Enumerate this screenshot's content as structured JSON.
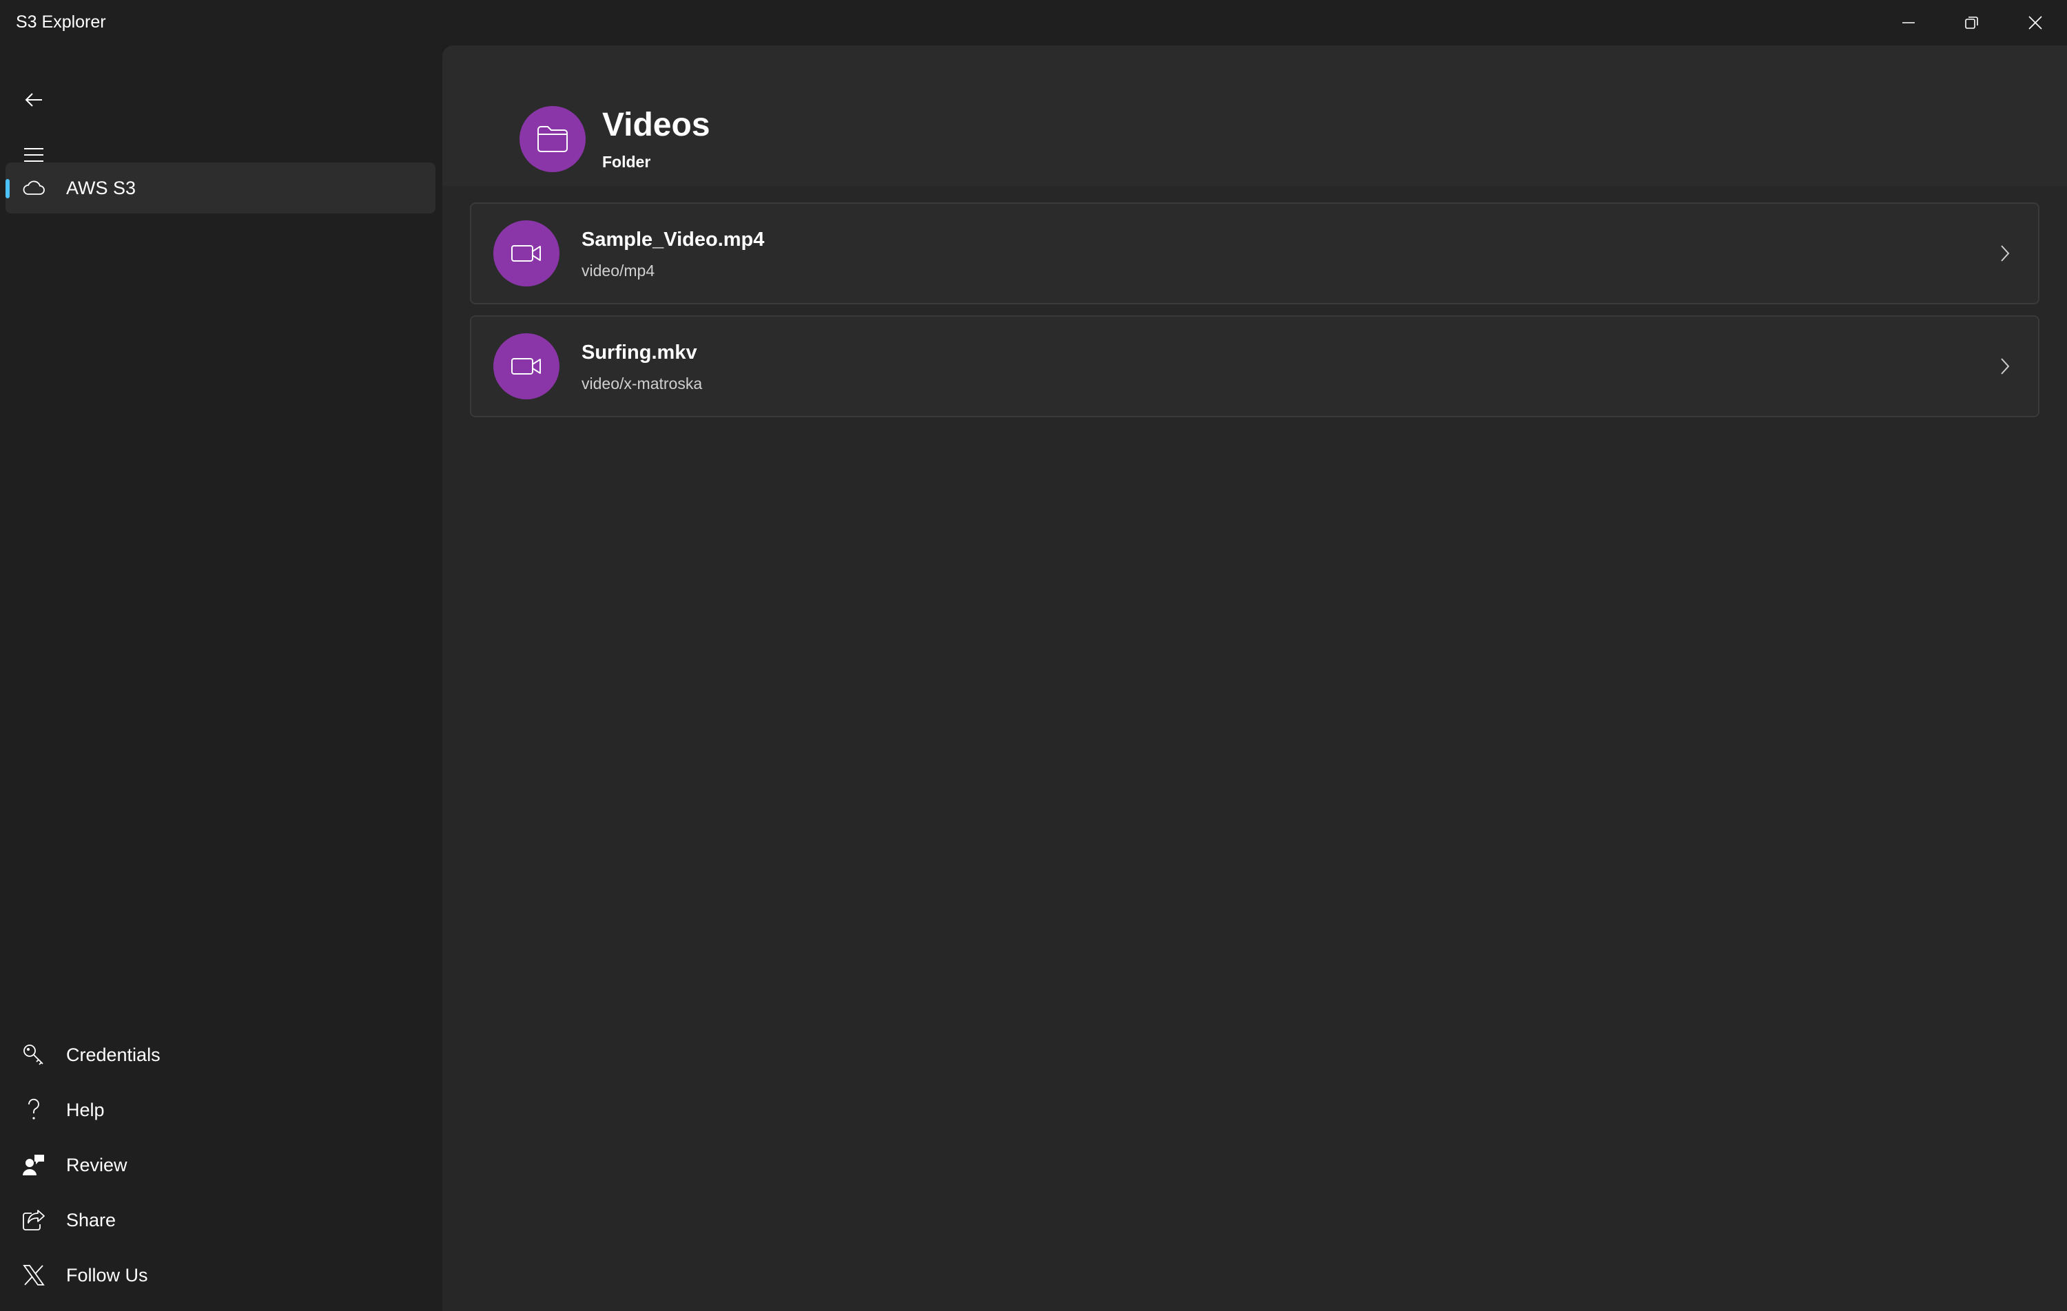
{
  "window": {
    "title": "S3 Explorer"
  },
  "sidebar": {
    "top_items": [
      {
        "label": "AWS S3",
        "icon": "cloud-icon",
        "selected": true
      }
    ],
    "footer_items": [
      {
        "label": "Credentials",
        "icon": "key-icon"
      },
      {
        "label": "Help",
        "icon": "question-icon"
      },
      {
        "label": "Review",
        "icon": "person-feedback-icon"
      },
      {
        "label": "Share",
        "icon": "share-icon"
      },
      {
        "label": "Follow Us",
        "icon": "x-logo-icon"
      }
    ]
  },
  "header": {
    "title": "Videos",
    "subtitle": "Folder",
    "icon": "folder-icon"
  },
  "files": [
    {
      "name": "Sample_Video.mp4",
      "type": "video/mp4",
      "icon": "video-camera-icon"
    },
    {
      "name": "Surfing.mkv",
      "type": "video/x-matroska",
      "icon": "video-camera-icon"
    }
  ],
  "colors": {
    "accent": "#4cc2ff",
    "avatar": "#8a36a8",
    "background": "#1f1f1f",
    "content": "#272727"
  }
}
